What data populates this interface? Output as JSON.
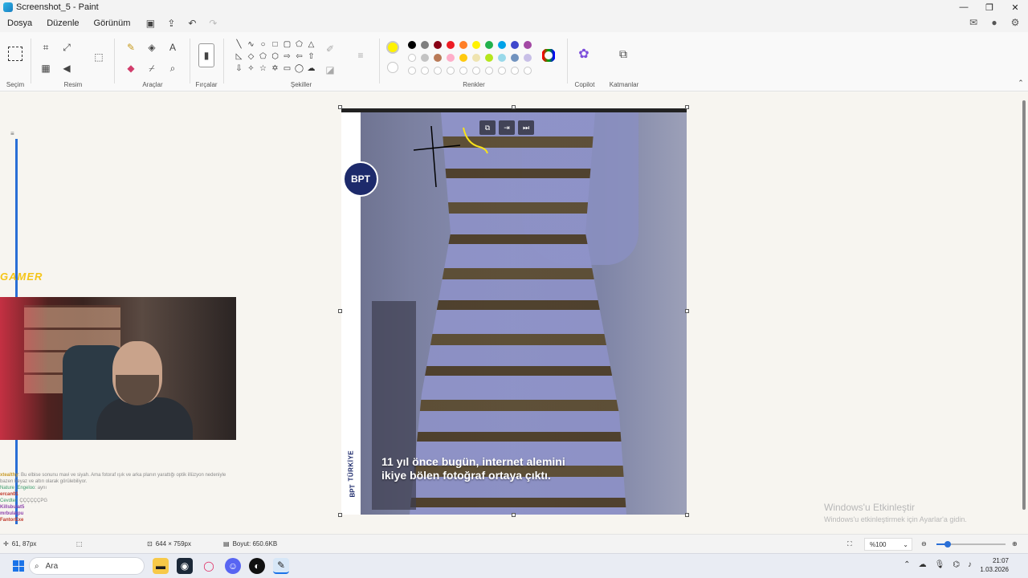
{
  "window": {
    "title": "Screenshot_5 - Paint",
    "controls": [
      "—",
      "❐",
      "✕"
    ]
  },
  "menu": {
    "items": [
      "Dosya",
      "Düzenle",
      "Görünüm"
    ]
  },
  "ribbon": {
    "groups": {
      "selection": "Seçim",
      "image": "Resim",
      "tools": "Araçlar",
      "brushes": "Fırçalar",
      "shapes": "Şekiller",
      "colors": "Renkler",
      "copilot": "Copilot",
      "layers": "Katmanlar"
    },
    "palette_row1": [
      "#000000",
      "#7f7f7f",
      "#880015",
      "#ed1c24",
      "#ff7f27",
      "#fff200",
      "#22b14c",
      "#00a2e8",
      "#3f48cc",
      "#a349a4"
    ],
    "palette_row2": [
      "#ffffff",
      "#c3c3c3",
      "#b97a57",
      "#ffaec9",
      "#ffc90e",
      "#efe4b0",
      "#b5e61d",
      "#99d9ea",
      "#7092be",
      "#c8bfe7"
    ],
    "active_color": "#fff200"
  },
  "overlay": {
    "gamer_label": "GAMER",
    "chat": [
      {
        "user": "xtealthy",
        "text": ": Bu elbise sonunu mavi ve siyah. Ama fotoraf ışık ve arka planın yarattığı optik illüzyon nedeniyle bazen beyaz ve altın olarak görülebiliyor."
      },
      {
        "user": "Nature_Engeloo",
        "text": ": aynı"
      },
      {
        "user": "ercan01",
        "text": ""
      },
      {
        "user": "Cevdter",
        "text": ": ÇÇÇÇÇÇPG"
      },
      {
        "user": "Killsbulat5",
        "text": ""
      },
      {
        "user": "mrbulatpu",
        "text": ""
      },
      {
        "user": "FantorExe",
        "text": ""
      }
    ]
  },
  "image": {
    "logo": "BPT",
    "side_text": "TÜRKİYE",
    "side_text2": "BPT",
    "caption_line1": "11 yıl önce bugün, internet alemini",
    "caption_line2": "ikiye bölen fotoğraf ortaya çıktı."
  },
  "watermark": {
    "line1": "Windows'u Etkinleştir",
    "line2": "Windows'u etkinleştirmek için Ayarlar'a gidin."
  },
  "status": {
    "cursor": "61, 87px",
    "dimensions": "644 × 759px",
    "size": "Boyut: 650.6KB",
    "zoom": "%100"
  },
  "taskbar": {
    "search_placeholder": "Ara",
    "time": "21:07",
    "date": "1.03.2026"
  }
}
